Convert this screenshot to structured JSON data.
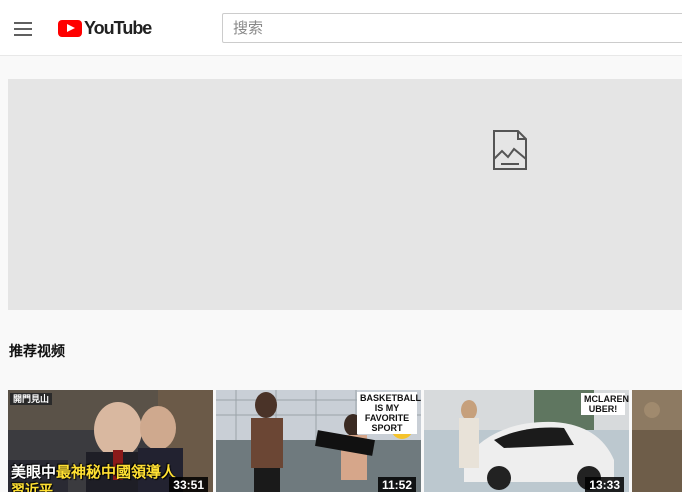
{
  "header": {
    "logo_text": "YouTube",
    "search_placeholder": "搜索"
  },
  "section": {
    "title": "推荐视频"
  },
  "videos": [
    {
      "overlay_line1_white": "美眼中",
      "overlay_line1_yellow": "最神秘中國領導人",
      "overlay_line2": "習近平",
      "duration": "33:51",
      "corner_tag": "開門見山"
    },
    {
      "corner_tag": "BASKETBALL IS MY FAVORITE SPORT",
      "duration": "11:52"
    },
    {
      "corner_tag": "MCLAREN UBER!",
      "duration": "13:33"
    }
  ],
  "colors": {
    "brand_red": "#ff0000",
    "highlight_yellow": "#ffe033",
    "banner_bg": "#e5e5e5"
  }
}
